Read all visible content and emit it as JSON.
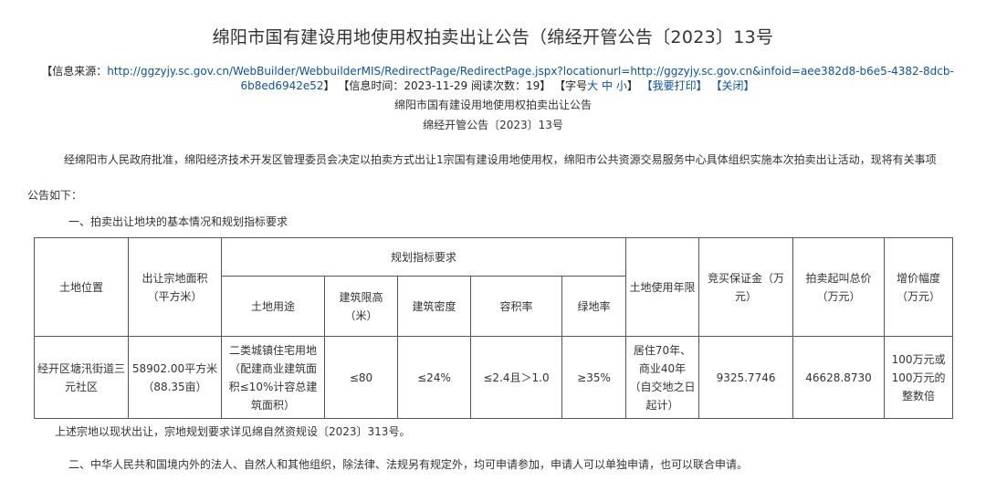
{
  "title": "绵阳市国有建设用地使用权拍卖出让公告（绵经开管公告〔2023〕13号",
  "info": {
    "source_prefix": "【信息来源：",
    "source_url": "http://ggzyjy.sc.gov.cn/WebBuilder/WebbuilderMIS/RedirectPage/RedirectPage.jspx?locationurl=http://ggzyjy.sc.gov.cn&infoid=aee382d8-b6e5-4382-8dcb-6b8ed6942e52",
    "source_suffix": "】",
    "time_label": "【信息时间：",
    "time_value": "2023-11-29",
    "views_label": "阅读次数：",
    "views_value": "19",
    "views_suffix": "】",
    "font_label": "【字号",
    "font_large": "大",
    "font_medium": "中",
    "font_small": "小",
    "font_suffix": "】",
    "print": "【我要打印】",
    "close": "【关闭】"
  },
  "subtitle1": "绵阳市国有建设用地使用权拍卖出让公告",
  "subtitle2": "绵经开管公告〔2023〕13号",
  "paragraph1": "经绵阳市人民政府批准，绵阳经济技术开发区管理委员会决定以拍卖方式出让1宗国有建设用地使用权，绵阳市公共资源交易服务中心具体组织实施本次拍卖出让活动，现将有关事项",
  "paragraph1b": "公告如下：",
  "section1": "一、拍卖出让地块的基本情况和规划指标要求",
  "table": {
    "h_location": "土地位置",
    "h_area": "出让宗地面积（平方米）",
    "h_planning": "规划指标要求",
    "h_use_period": "土地使用年限",
    "h_deposit": "竞买保证金（万元）",
    "h_start_price": "拍卖起叫总价（万元）",
    "h_increment": "增价幅度（万元）",
    "h_land_use": "土地用途",
    "h_height": "建筑限高（米）",
    "h_density": "建筑密度",
    "h_far": "容积率",
    "h_green": "绿地率",
    "r_location": "经开区塘汛街道三元社区",
    "r_area": "58902.00平方米（88.35亩）",
    "r_land_use": "二类城镇住宅用地（配建商业建筑面积≤10%计容总建筑面积）",
    "r_height": "≤80",
    "r_density": "≤24%",
    "r_far": "≤2.4且＞1.0",
    "r_green": "≥35%",
    "r_use_period": "居住70年、商业40年（自交地之日起计）",
    "r_deposit": "9325.7746",
    "r_start_price": "46628.8730",
    "r_increment": "100万元或100万元的整数倍"
  },
  "paragraph2": "上述宗地以现状出让，宗地规划要求详见绵自然资规设〔2023〕313号。",
  "section2": "二、中华人民共和国境内外的法人、自然人和其他组织，除法律、法规另有规定外，均可申请参加，申请人可以单独申请，也可以联合申请。"
}
